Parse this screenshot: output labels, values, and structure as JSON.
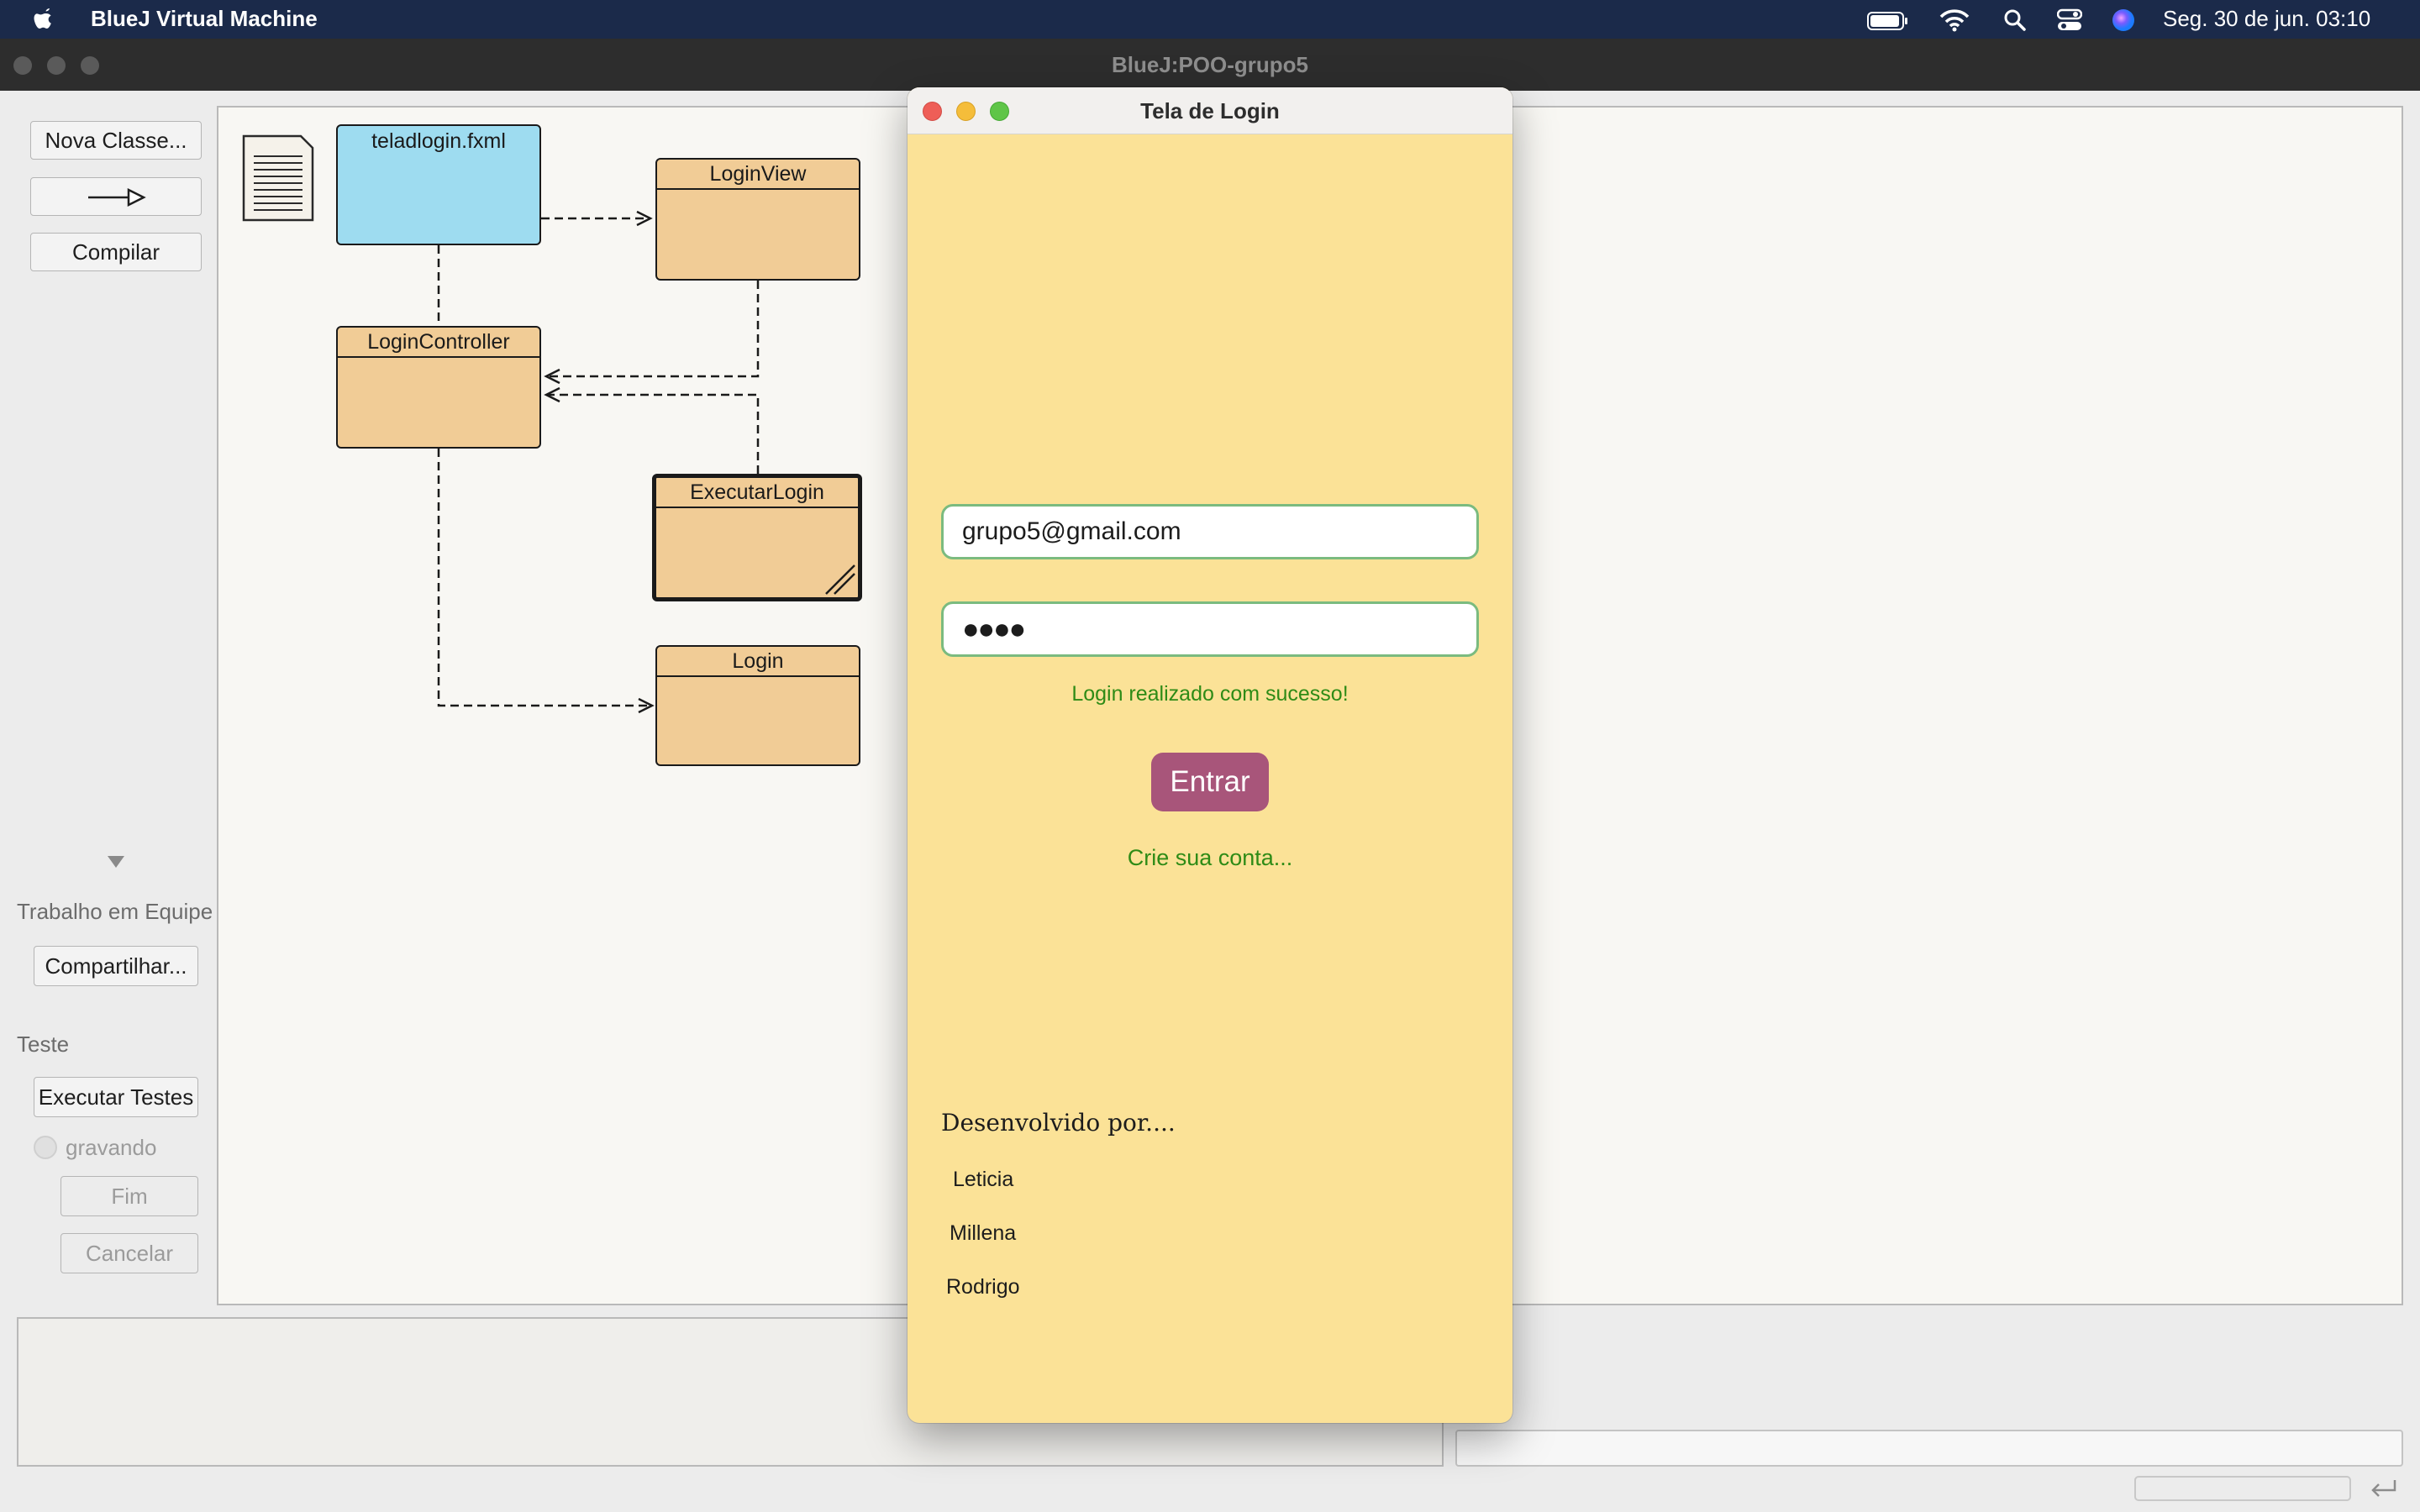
{
  "menubar": {
    "app_name": "BlueJ Virtual Machine",
    "clock": "Seg. 30 de jun.  03:10",
    "icons": [
      "apple-icon",
      "battery-icon",
      "wifi-icon",
      "search-icon",
      "control-center-icon",
      "siri-icon"
    ]
  },
  "bluej": {
    "window_title": "BlueJ:POO-grupo5",
    "sidebar": {
      "new_class": "Nova Classe...",
      "arrow_button": "inheritance-arrow-icon",
      "compile": "Compilar",
      "teamwork_label": "Trabalho em Equipe",
      "share": "Compartilhar...",
      "test_label": "Teste",
      "run_tests": "Executar Testes",
      "recording": "gravando",
      "end": "Fim",
      "cancel": "Cancelar"
    },
    "diagram": {
      "fxml_file": "teladlogin.fxml",
      "classes": {
        "login_view": "LoginView",
        "login_controller": "LoginController",
        "executar_login": "ExecutarLogin",
        "login": "Login"
      }
    }
  },
  "login_window": {
    "title": "Tela de Login",
    "email_value": "grupo5@gmail.com",
    "password_mask": "●●●●",
    "success_message": "Login realizado com sucesso!",
    "enter_button": "Entrar",
    "create_account_link": "Crie sua conta...",
    "developed_by": "Desenvolvido por....",
    "developers": [
      "Leticia",
      "Millena",
      "Rodrigo"
    ]
  },
  "colors": {
    "login_bg": "#fbe297",
    "enter_button": "#a8557a",
    "success_text": "#2e8b16",
    "class_fill": "#f1cc96",
    "fxml_fill": "#9edcf0"
  }
}
